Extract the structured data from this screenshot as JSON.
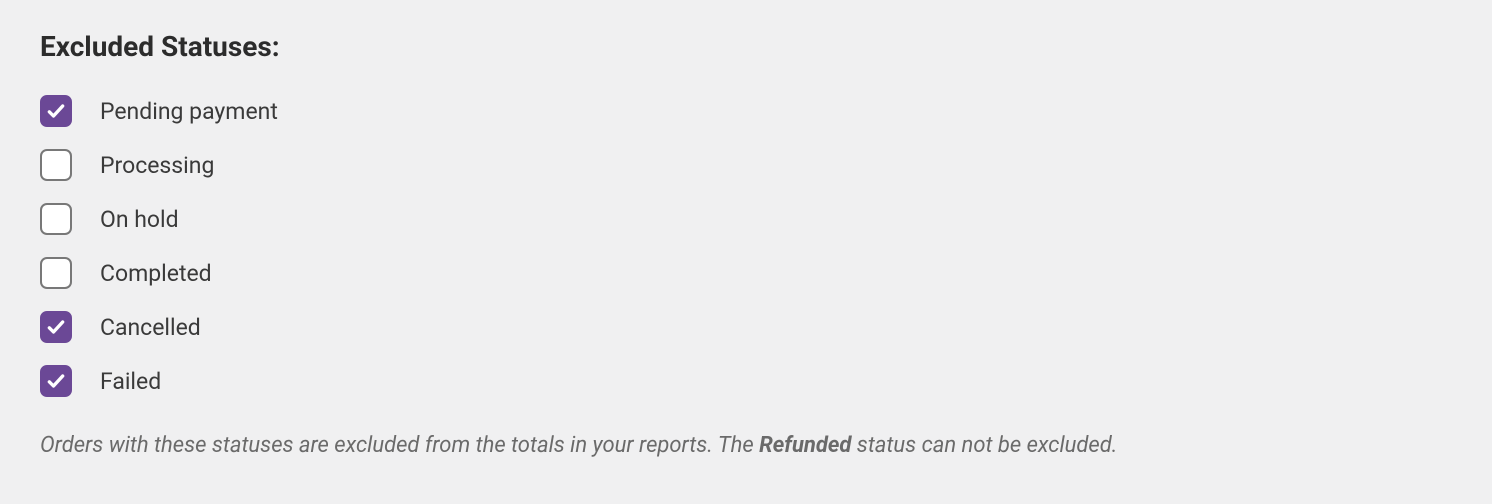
{
  "heading": "Excluded Statuses:",
  "statuses": [
    {
      "label": "Pending payment",
      "checked": true
    },
    {
      "label": "Processing",
      "checked": false
    },
    {
      "label": "On hold",
      "checked": false
    },
    {
      "label": "Completed",
      "checked": false
    },
    {
      "label": "Cancelled",
      "checked": true
    },
    {
      "label": "Failed",
      "checked": true
    }
  ],
  "description_prefix": "Orders with these statuses are excluded from the totals in your reports. The ",
  "description_bold": "Refunded",
  "description_suffix": " status can not be excluded."
}
